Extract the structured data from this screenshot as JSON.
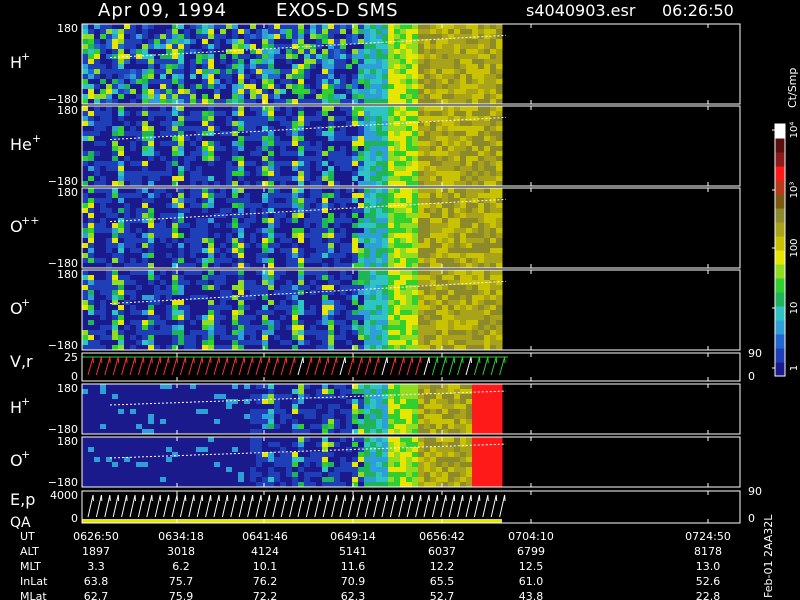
{
  "header": {
    "date": "Apr 09, 1994",
    "instrument": "EXOS-D SMS",
    "file": "s4040903.esr",
    "time": "06:26:50"
  },
  "colorbar": {
    "unit_label": "Ct/Smp",
    "ticks": [
      "1",
      "10",
      "100",
      "10³",
      "10⁴"
    ],
    "colors": [
      "#1a1a8c",
      "#1f3fb8",
      "#2266d0",
      "#2e9fd8",
      "#2ec4c4",
      "#1fb35a",
      "#2fd02f",
      "#8fdc20",
      "#e6e600",
      "#c9c200",
      "#a8a31a",
      "#8c8a2a",
      "#7a5a10",
      "#b83a1a",
      "#ff1a1a",
      "#8c1a1a",
      "#5a0f0f",
      "#ffffff"
    ]
  },
  "footer": {
    "side_text": "Feb-01 2AA32L"
  },
  "chart_data": {
    "type": "heatmap",
    "time_axis": {
      "labels": [
        "0626:50",
        "0634:18",
        "0641:46",
        "0649:14",
        "0656:42",
        "0704:10",
        "0724:50"
      ]
    },
    "panels": [
      {
        "id": "p1",
        "label": "H",
        "sup": "+",
        "ymax": "180",
        "ymin": "−180",
        "kind": "spec"
      },
      {
        "id": "p2",
        "label": "He",
        "sup": "+",
        "ymax": "180",
        "ymin": "−180",
        "kind": "spec"
      },
      {
        "id": "p3",
        "label": "O",
        "sup": "++",
        "ymax": "180",
        "ymin": "−180",
        "kind": "spec"
      },
      {
        "id": "p4",
        "label": "O",
        "sup": "+",
        "ymax": "180",
        "ymin": "−180",
        "kind": "spec"
      },
      {
        "id": "p5",
        "label": "V,r",
        "sup": "",
        "ymax": "25",
        "ymin": "0",
        "right_top": "90",
        "right_bot": "0",
        "kind": "line"
      },
      {
        "id": "p6",
        "label": "H",
        "sup": "+",
        "ymax": "180",
        "ymin": "−180",
        "kind": "spec"
      },
      {
        "id": "p7",
        "label": "O",
        "sup": "+",
        "ymax": "180",
        "ymin": "−180",
        "kind": "spec"
      },
      {
        "id": "p8",
        "label": "E,p",
        "label2": "QA",
        "sup": "",
        "ymax": "4000",
        "ymin": "0",
        "right_top": "90",
        "right_bot": "0",
        "kind": "line"
      }
    ],
    "ephemeris": [
      {
        "name": "UT",
        "values": [
          "0626:50",
          "0634:18",
          "0641:46",
          "0649:14",
          "0656:42",
          "0704:10",
          "0724:50"
        ]
      },
      {
        "name": "ALT",
        "values": [
          "1897",
          "3018",
          "4124",
          "5141",
          "6037",
          "6799",
          "8178"
        ]
      },
      {
        "name": "MLT",
        "values": [
          "3.3",
          "6.2",
          "10.1",
          "11.6",
          "12.2",
          "12.5",
          "13.0"
        ]
      },
      {
        "name": "InLat",
        "values": [
          "63.8",
          "75.7",
          "76.2",
          "70.9",
          "65.5",
          "61.0",
          "52.6"
        ]
      },
      {
        "name": "MLat",
        "values": [
          "62.7",
          "75.9",
          "72.2",
          "62.3",
          "52.7",
          "43.8",
          "22.8"
        ]
      }
    ]
  }
}
